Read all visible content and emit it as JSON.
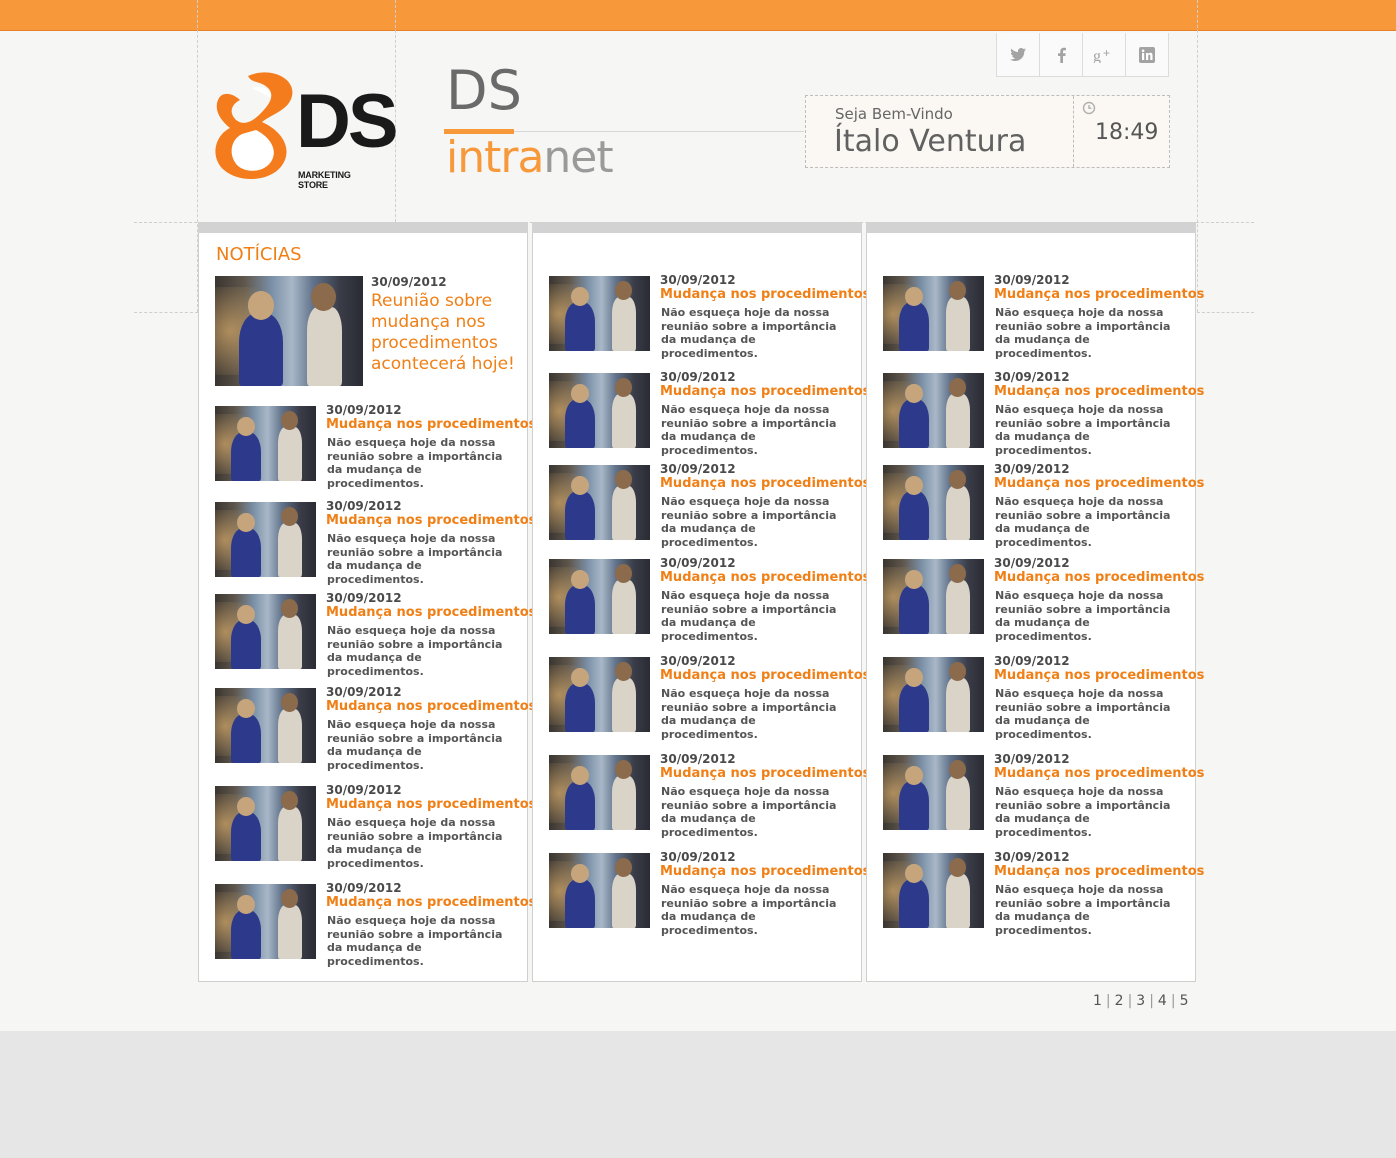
{
  "brand": {
    "logo_text": "DS",
    "logo_subtext": "MARKETING STORE",
    "title": "DS",
    "subtitle_orange": "intra",
    "subtitle_gray": "net"
  },
  "social": [
    {
      "name": "twitter",
      "icon": "twitter-icon"
    },
    {
      "name": "facebook",
      "icon": "facebook-icon"
    },
    {
      "name": "google-plus",
      "icon": "google-plus-icon"
    },
    {
      "name": "linkedin",
      "icon": "linkedin-icon"
    }
  ],
  "welcome": {
    "label": "Seja Bem-Vindo",
    "user_name": "Ítalo Ventura",
    "time": "18:49"
  },
  "news": {
    "section_title": "NOTÍCIAS",
    "featured": {
      "date": "30/09/2012",
      "title": "Reunião sobre mudança nos procedimentos acontecerá hoje!"
    },
    "item": {
      "date": "30/09/2012",
      "title": "Mudança nos procedimentos",
      "text": "Não esqueça hoje da nossa reunião sobre a importância da mudança de procedimentos."
    }
  },
  "pagination": [
    "1",
    "2",
    "3",
    "4",
    "5"
  ],
  "colors": {
    "accent": "#f7993a",
    "accent_text": "#f07f16",
    "text_gray": "#555555"
  }
}
